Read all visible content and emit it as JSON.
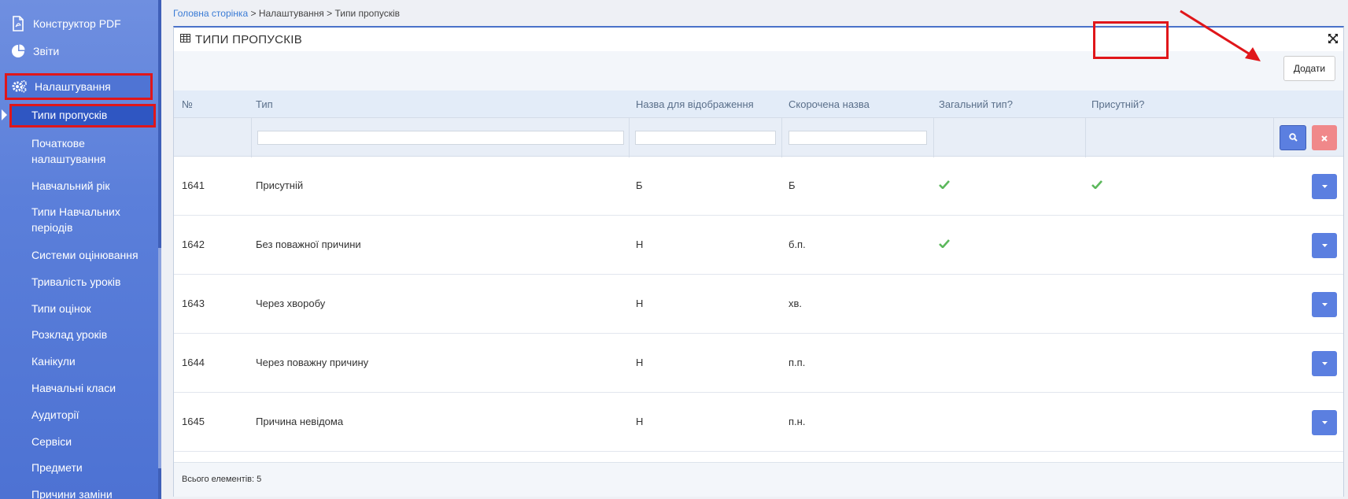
{
  "sidebar": {
    "main_items": [
      {
        "label": "Конструктор PDF",
        "icon": "pdf-file-icon"
      },
      {
        "label": "Звіти",
        "icon": "pie-chart-icon"
      },
      {
        "label": "Налаштування",
        "icon": "gears-icon"
      }
    ],
    "sub_items": [
      {
        "label": "Типи пропусків"
      },
      {
        "label": "Початкове налаштування"
      },
      {
        "label": "Навчальний рік"
      },
      {
        "label": "Типи Навчальних періодів"
      },
      {
        "label": "Системи оцінювання"
      },
      {
        "label": "Тривалість уроків"
      },
      {
        "label": "Типи оцінок"
      },
      {
        "label": "Розклад уроків"
      },
      {
        "label": "Канікули"
      },
      {
        "label": "Навчальні класи"
      },
      {
        "label": "Аудиторії"
      },
      {
        "label": "Сервіси"
      },
      {
        "label": "Предмети"
      },
      {
        "label": "Причини заміни"
      }
    ]
  },
  "breadcrumb": {
    "home": "Головна сторінка",
    "sep1": " > ",
    "settings": "Налаштування",
    "sep2": " > ",
    "current": "Типи пропусків"
  },
  "panel": {
    "title": "ТИПИ ПРОПУСКІВ",
    "add_label": "Додати"
  },
  "table": {
    "columns": [
      "№",
      "Тип",
      "Назва для відображення",
      "Скорочена назва",
      "Загальний тип?",
      "Присутній?"
    ],
    "rows": [
      {
        "id": "1641",
        "type": "Присутній",
        "display": "Б",
        "short": "Б",
        "general": true,
        "present": true
      },
      {
        "id": "1642",
        "type": "Без поважної причини",
        "display": "Н",
        "short": "б.п.",
        "general": true,
        "present": false
      },
      {
        "id": "1643",
        "type": "Через хворобу",
        "display": "Н",
        "short": "хв.",
        "general": false,
        "present": false
      },
      {
        "id": "1644",
        "type": "Через поважну причину",
        "display": "Н",
        "short": "п.п.",
        "general": false,
        "present": false
      },
      {
        "id": "1645",
        "type": "Причина невідома",
        "display": "Н",
        "short": "п.н.",
        "general": false,
        "present": false
      }
    ]
  },
  "footer": {
    "total": "Всього елементів: 5"
  },
  "colors": {
    "sidebar": "#5b7fda",
    "accent": "#5b7fe0",
    "highlight": "#e0161a",
    "check": "#5cb85c"
  }
}
